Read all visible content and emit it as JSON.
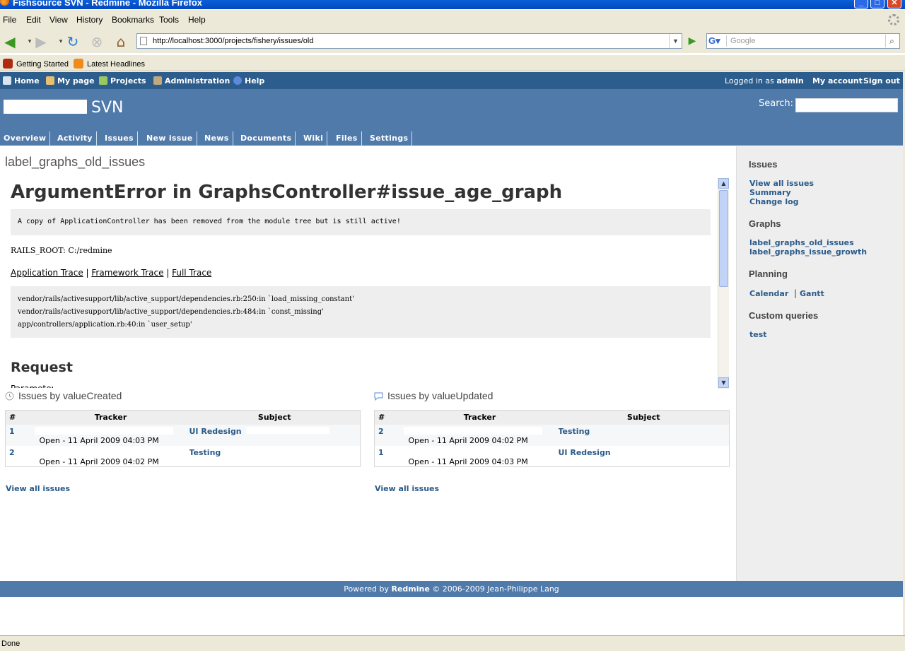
{
  "window": {
    "title": "Fishsource SVN - Redmine - Mozilla Firefox"
  },
  "browser": {
    "menu": [
      "File",
      "Edit",
      "View",
      "History",
      "Bookmarks",
      "Tools",
      "Help"
    ],
    "url": "http://localhost:3000/projects/fishery/issues/old",
    "search_placeholder": "Google",
    "bookmarks": [
      "Getting Started",
      "Latest Headlines"
    ],
    "status": "Done"
  },
  "redmine": {
    "top_menu": [
      "Home",
      "My page",
      "Projects",
      "Administration",
      "Help"
    ],
    "logged_in_prefix": "Logged in as",
    "logged_in_user": "admin",
    "my_account": "My account",
    "sign_out": "Sign out",
    "project_title": "SVN",
    "search_label": "Search:",
    "tabs": [
      "Overview",
      "Activity",
      "Issues",
      "New issue",
      "News",
      "Documents",
      "Wiki",
      "Files",
      "Settings"
    ]
  },
  "content": {
    "heading": "label_graphs_old_issues",
    "error_title": "ArgumentError in GraphsController#issue_age_graph",
    "error_message": "A copy of ApplicationController has been removed from the module tree but is still active!",
    "rails_root": "RAILS_ROOT: C:/redmine",
    "trace_links": [
      "Application Trace",
      "Framework Trace",
      "Full Trace"
    ],
    "trace_lines": [
      "vendor/rails/activesupport/lib/active_support/dependencies.rb:250:in `load_missing_constant'",
      "vendor/rails/activesupport/lib/active_support/dependencies.rb:484:in `const_missing'",
      "app/controllers/application.rb:40:in `user_setup'"
    ],
    "request_heading": "Request",
    "request_cut": "Parameters"
  },
  "boxes": [
    {
      "title": "Issues by valueCreated",
      "columns": [
        "#",
        "Tracker",
        "Subject"
      ],
      "rows": [
        {
          "id": "1",
          "status": "Open - 11 April 2009 04:03 PM",
          "subject": "UI Redesign"
        },
        {
          "id": "2",
          "status": "Open - 11 April 2009 04:02 PM",
          "subject": "Testing"
        }
      ],
      "view_all": "View all issues"
    },
    {
      "title": "Issues by valueUpdated",
      "columns": [
        "#",
        "Tracker",
        "Subject"
      ],
      "rows": [
        {
          "id": "2",
          "status": "Open - 11 April 2009 04:02 PM",
          "subject": "Testing"
        },
        {
          "id": "1",
          "status": "Open - 11 April 2009 04:03 PM",
          "subject": "UI Redesign"
        }
      ],
      "view_all": "View all issues"
    }
  ],
  "sidebar": {
    "issues_heading": "Issues",
    "issues_links": [
      "View all issues",
      "Summary",
      "Change log"
    ],
    "graphs_heading": "Graphs",
    "graphs_links": [
      "label_graphs_old_issues",
      "label_graphs_issue_growth"
    ],
    "planning_heading": "Planning",
    "planning_links": [
      "Calendar",
      "Gantt"
    ],
    "planning_sep": "|",
    "queries_heading": "Custom queries",
    "queries_links": [
      "test"
    ]
  },
  "footer": {
    "prefix": "Powered by",
    "brand": "Redmine",
    "suffix": "© 2006-2009 Jean-Philippe Lang"
  },
  "colors": {
    "header": "#507aaa",
    "topmenu": "#2c5d8d",
    "link": "#2a5a8a"
  }
}
